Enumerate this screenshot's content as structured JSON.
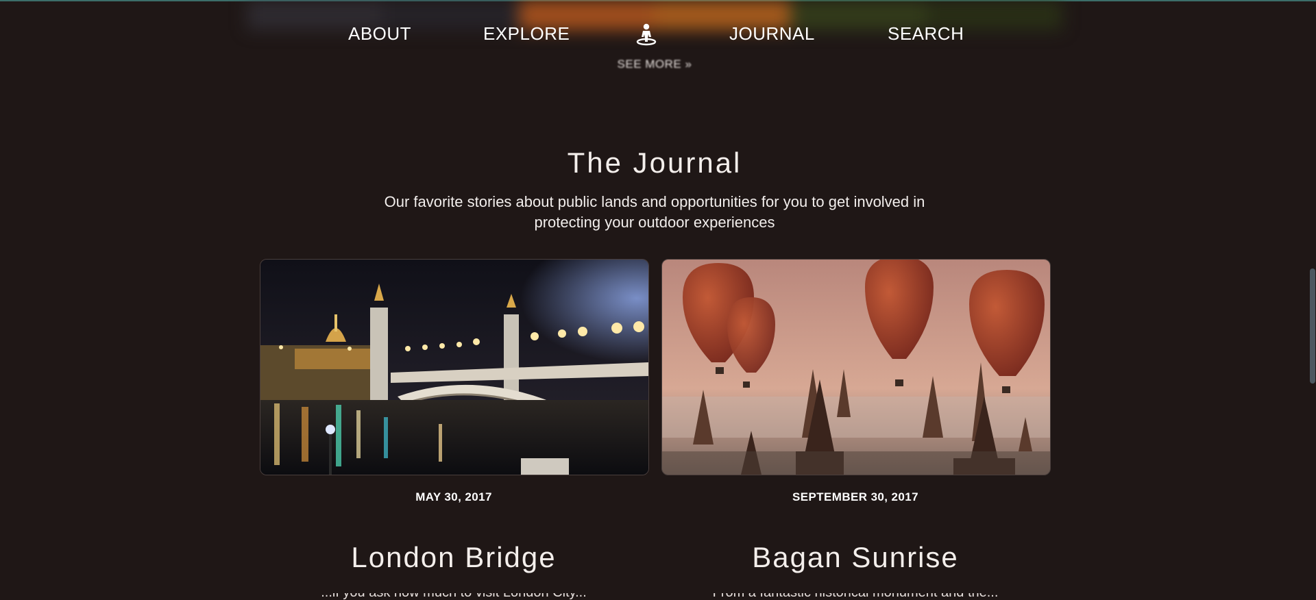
{
  "nav": {
    "about": "ABOUT",
    "explore": "EXPLORE",
    "logo_icon": "hiker-person-icon",
    "journal": "JOURNAL",
    "search": "SEARCH"
  },
  "previous_section": {
    "see_more": "SEE MORE »"
  },
  "journal": {
    "title": "The Journal",
    "subtitle": "Our favorite stories about public lands and opportunities for you to get involved in protecting your outdoor experiences"
  },
  "cards": [
    {
      "image_icon": "night-bridge-photo",
      "date": "MAY 30, 2017",
      "title": "London Bridge",
      "excerpt": "...if you ask how much to visit London City..."
    },
    {
      "image_icon": "hot-air-balloons-photo",
      "date": "SEPTEMBER 30, 2017",
      "title": "Bagan Sunrise",
      "excerpt": "From a fantastic historical monument and the..."
    }
  ],
  "colors": {
    "background": "#1f1716",
    "text": "#ffffff",
    "accent_line": "#3c6e6a",
    "balloon": "#b4452a",
    "sky_dusk": "#d19d86"
  }
}
